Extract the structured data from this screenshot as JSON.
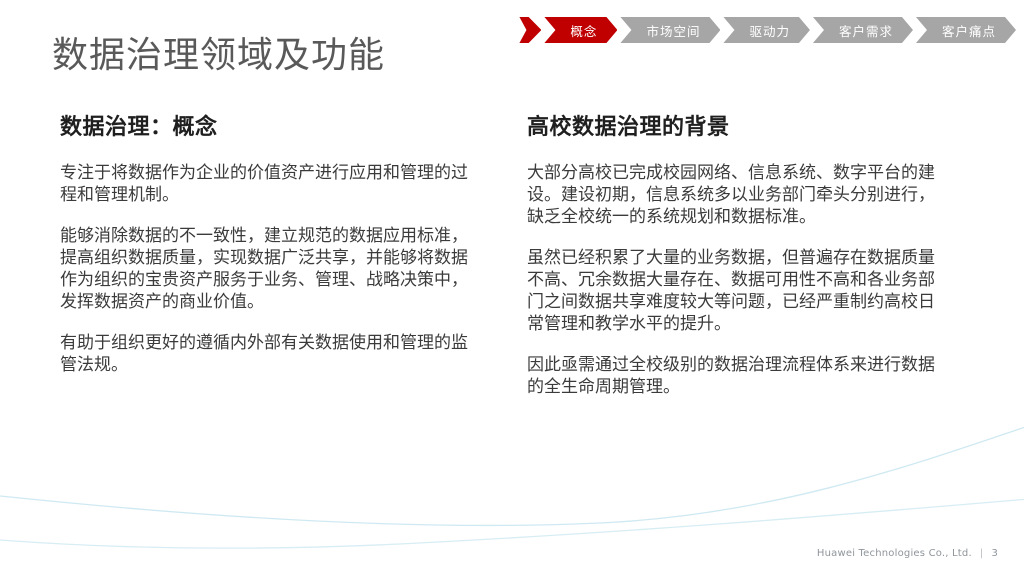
{
  "slide": {
    "title": "数据治理领域及功能",
    "footer": {
      "company": "Huawei Technologies Co., Ltd.",
      "separator": "|",
      "page_number": "3"
    }
  },
  "nav": {
    "items": [
      {
        "label": "概念",
        "active": true
      },
      {
        "label": "市场空间",
        "active": false
      },
      {
        "label": "驱动力",
        "active": false
      },
      {
        "label": "客户需求",
        "active": false
      },
      {
        "label": "客户痛点",
        "active": false
      }
    ],
    "active_color": "#c00000",
    "inactive_color": "#a6a6a6"
  },
  "columns": {
    "left": {
      "heading": "数据治理：概念",
      "paragraphs": [
        "专注于将数据作为企业的价值资产进行应用和管理的过程和管理机制。",
        "能够消除数据的不一致性，建立规范的数据应用标准，提高组织数据质量，实现数据广泛共享，并能够将数据作为组织的宝贵资产服务于业务、管理、战略决策中，发挥数据资产的商业价值。",
        "有助于组织更好的遵循内外部有关数据使用和管理的监管法规。"
      ]
    },
    "right": {
      "heading": "高校数据治理的背景",
      "paragraphs": [
        "大部分高校已完成校园网络、信息系统、数字平台的建设。建设初期，信息系统多以业务部门牵头分别进行，缺乏全校统一的系统规划和数据标准。",
        "虽然已经积累了大量的业务数据，但普遍存在数据质量不高、冗余数据大量存在、数据可用性不高和各业务部门之间数据共享难度较大等问题，已经严重制约高校日常管理和教学水平的提升。",
        "因此亟需通过全校级别的数据治理流程体系来进行数据的全生命周期管理。"
      ]
    }
  },
  "decor": {
    "wave_color": "#cfe9f2"
  }
}
